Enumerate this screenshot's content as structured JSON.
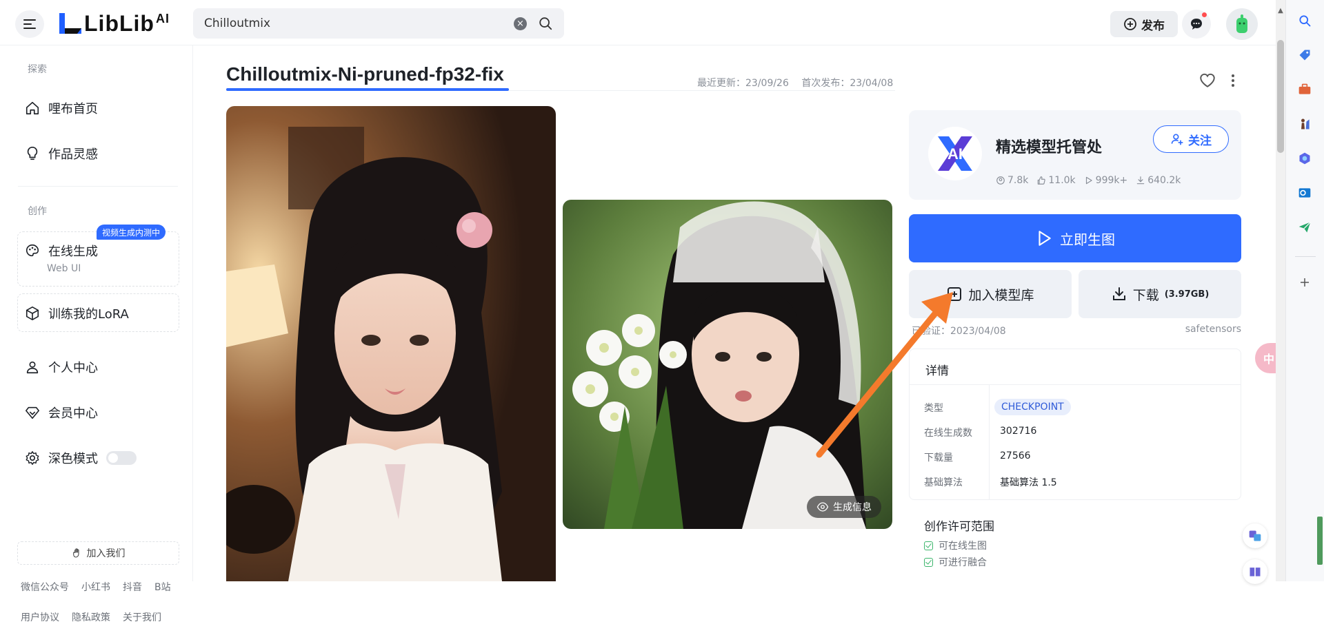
{
  "header": {
    "logo_text": "LibLib",
    "logo_ai": "AI",
    "search_value": "Chilloutmix",
    "publish_label": "发布"
  },
  "sidebar": {
    "section_explore": "探索",
    "home_label": "哩布首页",
    "inspiration_label": "作品灵感",
    "section_create": "创作",
    "online_gen_label": "在线生成",
    "online_gen_sub": "Web UI",
    "online_gen_badge": "视频生成内测中",
    "train_label": "训练我的LoRA",
    "personal_label": "个人中心",
    "member_label": "会员中心",
    "dark_mode_label": "深色模式",
    "join_label": "加入我们",
    "social_links": [
      "微信公众号",
      "小红书",
      "抖音",
      "B站"
    ],
    "footer_links": [
      "用户协议",
      "隐私政策",
      "关于我们"
    ]
  },
  "model": {
    "title": "Chilloutmix-Ni-pruned-fp32-fix",
    "last_update": "最近更新：23/09/26",
    "first_release": "首次发布：23/04/08",
    "gen_info_label": "生成信息"
  },
  "author": {
    "name": "精选模型托管处",
    "follow_label": "关注",
    "stats": [
      "7.8k",
      "11.0k",
      "999k+",
      "640.2k"
    ]
  },
  "actions": {
    "generate_label": "立即生图",
    "add_library_label": "加入模型库",
    "download_label": "下载",
    "download_size": "(3.97GB)",
    "verified_text": "已验证：2023/04/08",
    "file_format": "safetensors"
  },
  "details": {
    "heading": "详情",
    "rows": [
      {
        "label": "类型",
        "value": "CHECKPOINT"
      },
      {
        "label": "在线生成数",
        "value": "302716"
      },
      {
        "label": "下载量",
        "value": "27566"
      },
      {
        "label": "基础算法",
        "value": "基础算法 1.5"
      }
    ]
  },
  "license": {
    "title": "创作许可范围",
    "items": [
      "可在线生图",
      "可进行融合"
    ]
  },
  "colors": {
    "accent": "#2f6bff",
    "arrow": "#f47a2c"
  }
}
